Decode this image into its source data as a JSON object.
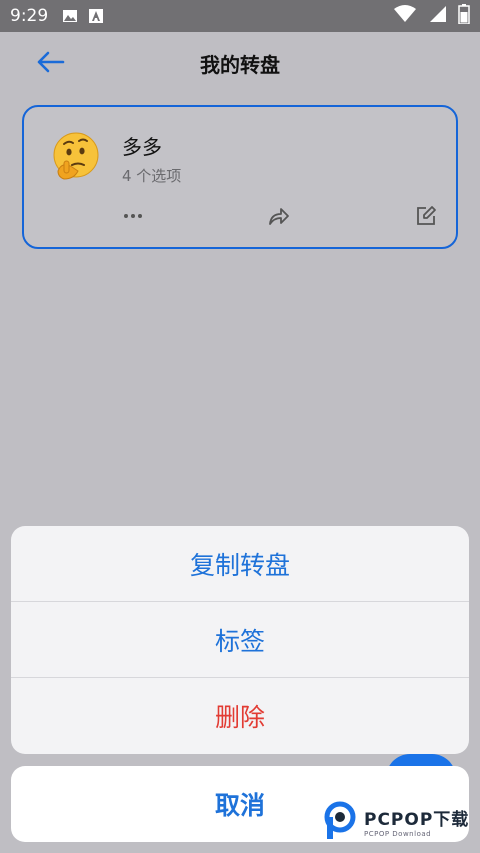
{
  "status_bar": {
    "time": "9:29",
    "icons": [
      "image-icon",
      "text-a-icon",
      "wifi-icon",
      "signal-icon",
      "battery-icon"
    ]
  },
  "header": {
    "title": "我的转盘"
  },
  "wheel_card": {
    "emoji": "thinking-face-emoji",
    "name": "多多",
    "option_count": "4 个选项",
    "actions": [
      "more-icon",
      "share-icon",
      "edit-icon"
    ]
  },
  "action_sheet": {
    "items": [
      {
        "label": "复制转盘",
        "color": "#1e72d9"
      },
      {
        "label": "标签",
        "color": "#1e72d9"
      },
      {
        "label": "删除",
        "color": "#e23b33"
      }
    ],
    "cancel_label": "取消"
  },
  "watermark": {
    "main": "PCPOP下载",
    "sub": "PCPOP Download"
  },
  "colors": {
    "accent": "#1e72d9",
    "danger": "#e23b33",
    "card_border": "#1565d8"
  }
}
